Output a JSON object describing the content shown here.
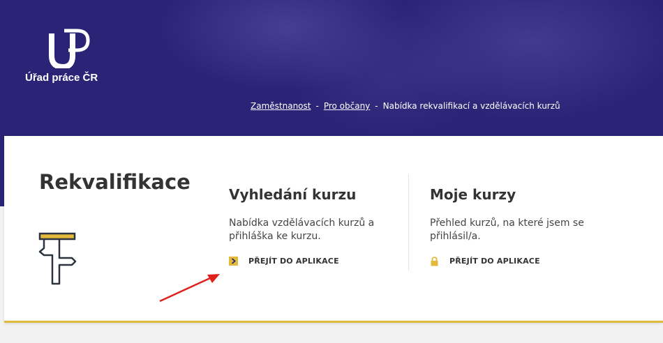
{
  "header": {
    "logo_text": "Úřad práce ČR",
    "breadcrumb": [
      {
        "label": "Zaměstnanost",
        "link": true
      },
      {
        "label": "Pro občany",
        "link": true
      },
      {
        "label": "Nabídka rekvalifikací a vzdělávacích kurzů",
        "link": false
      }
    ],
    "breadcrumb_separator": "-"
  },
  "card": {
    "title": "Rekvalifikace",
    "icon": "signpost-icon",
    "columns": [
      {
        "title": "Vyhledání kurzu",
        "description": "Nabídka vzdělávacích kurzů a přihláška ke kurzu.",
        "link_label": "PŘEJÍT DO APLIKACE",
        "link_icon": "chevron-right-icon"
      },
      {
        "title": "Moje kurzy",
        "description": "Přehled kurzů, na které jsem se přihlásil/a.",
        "link_label": "PŘEJÍT DO APLIKACE",
        "link_icon": "lock-icon"
      }
    ]
  },
  "colors": {
    "header_bg": "#2b2476",
    "accent": "#e3b93b",
    "annotation_arrow": "#e0201c"
  }
}
